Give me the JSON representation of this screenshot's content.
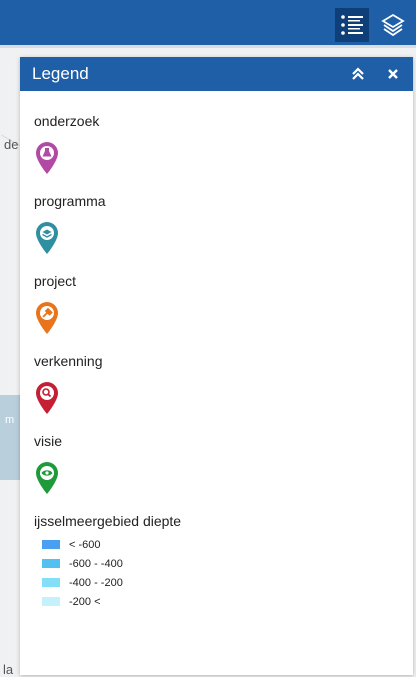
{
  "map": {
    "fragments": [
      "de",
      "m",
      "la"
    ]
  },
  "toolbar": {
    "tools": [
      {
        "name": "legend",
        "icon": "list-icon",
        "active": true
      },
      {
        "name": "layers",
        "icon": "layers-icon",
        "active": false
      }
    ]
  },
  "legend": {
    "title": "Legend",
    "collapse_icon": "double-chevron-up-icon",
    "close_icon": "close-icon",
    "layers": [
      {
        "label": "onderzoek",
        "icon": "flask-marker-icon",
        "color": "#b04aa5"
      },
      {
        "label": "programma",
        "icon": "stack-marker-icon",
        "color": "#2e8fa0"
      },
      {
        "label": "project",
        "icon": "tools-marker-icon",
        "color": "#e8741c"
      },
      {
        "label": "verkenning",
        "icon": "magnifier-marker-icon",
        "color": "#c41f35"
      },
      {
        "label": "visie",
        "icon": "eye-marker-icon",
        "color": "#1f9a3a"
      }
    ],
    "depth": {
      "title": "ijsselmeergebied diepte",
      "ranges": [
        {
          "label": "< -600",
          "color": "#4a9ff0"
        },
        {
          "label": "-600 - -400",
          "color": "#54c0f2"
        },
        {
          "label": "-400 - -200",
          "color": "#83dff8"
        },
        {
          "label": "-200 <",
          "color": "#c4f1fb"
        }
      ]
    }
  }
}
